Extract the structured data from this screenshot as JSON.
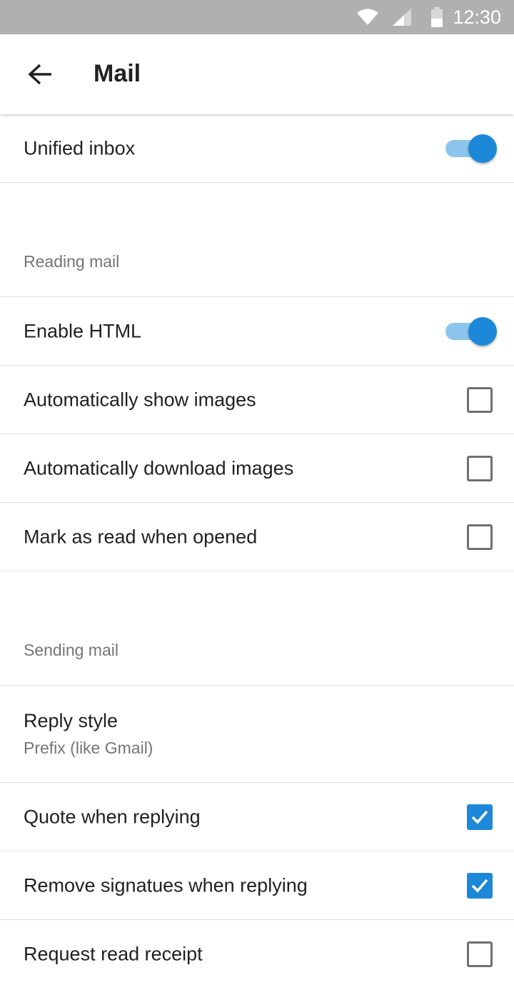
{
  "status_bar": {
    "time": "12:30",
    "icons": [
      "wifi-icon",
      "cellular-signal-icon",
      "battery-icon"
    ]
  },
  "app_bar": {
    "back_icon": "arrow-left-icon",
    "title": "Mail"
  },
  "colors": {
    "accent": "#1e88d8",
    "toggle_track": "#8ec5ec",
    "status_bar": "#b0b0b0"
  },
  "settings": {
    "unified_inbox": {
      "label": "Unified inbox",
      "on": true
    },
    "reading_mail": {
      "heading": "Reading mail",
      "enable_html": {
        "label": "Enable HTML",
        "on": true
      },
      "show_images": {
        "label": "Automatically show images",
        "checked": false
      },
      "download_images": {
        "label": "Automatically download images",
        "checked": false
      },
      "mark_read": {
        "label": "Mark as read when opened",
        "checked": false
      }
    },
    "sending_mail": {
      "heading": "Sending mail",
      "reply_style": {
        "label": "Reply style",
        "value": "Prefix (like Gmail)"
      },
      "quote_reply": {
        "label": "Quote when replying",
        "checked": true
      },
      "remove_signatures": {
        "label": "Remove signatues when replying",
        "checked": true
      },
      "read_receipt": {
        "label": "Request read receipt",
        "checked": false
      }
    }
  }
}
